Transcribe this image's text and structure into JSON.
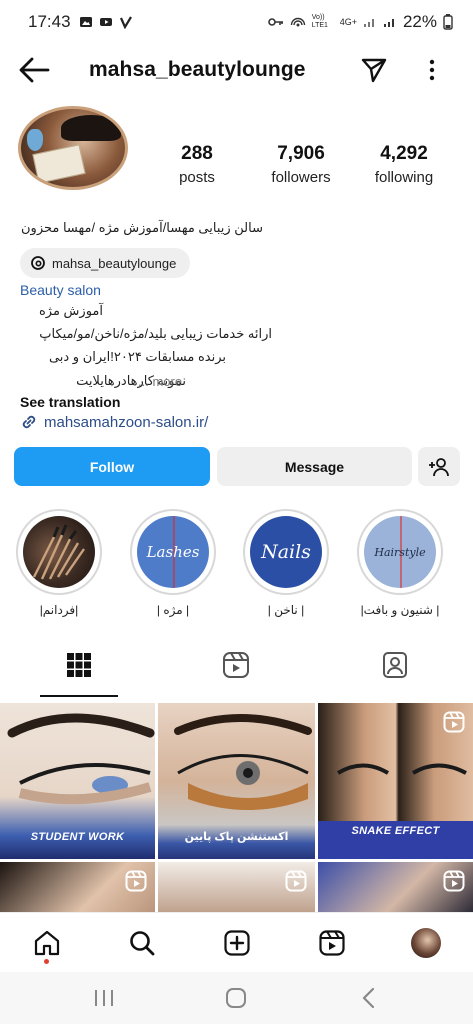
{
  "status_bar": {
    "time": "17:43",
    "network_label": "4G+",
    "volte_label": "Vo)) LTE1",
    "battery": "22%"
  },
  "header": {
    "username": "mahsa_beautylounge"
  },
  "profile": {
    "stats": [
      {
        "value": "288",
        "label": "posts"
      },
      {
        "value": "7,906",
        "label": "followers"
      },
      {
        "value": "4,292",
        "label": "following"
      }
    ],
    "name": "سالن زیبایی مهسا/آموزش مژه /مهسا محزون",
    "threads_handle": "mahsa_beautylounge",
    "category": "Beauty salon",
    "bio_lines": [
      "آموزش مژه",
      "ارائه خدمات زیبایی بلید/مژه/ناخن/مو/میکاپ",
      "برنده مسابقات ۲۰۲۴!ایران و دبی",
      "نمونه کارهادرهایلایت"
    ],
    "more_label": "... more",
    "see_translation": "See translation",
    "link": "mahsamahzoon-salon.ir/"
  },
  "actions": {
    "follow": "Follow",
    "message": "Message"
  },
  "highlights": [
    {
      "label": "|فردانم|",
      "word": "",
      "color": "#3b2a22"
    },
    {
      "label": "| مژه |",
      "word": "Lashes",
      "color": "#4f7cc9"
    },
    {
      "label": "| ناخن |",
      "word": "Nails",
      "color": "#2c4fa6"
    },
    {
      "label": "| شنیون و بافت|",
      "word": "Hairstyle",
      "color": "#9bb3d8"
    }
  ],
  "posts": [
    {
      "caption": "STUDENT WORK"
    },
    {
      "caption": "اکستنشن پاک پایین"
    },
    {
      "caption": "SNAKE EFFECT"
    }
  ],
  "icons": {
    "back": "arrow-left-icon",
    "send": "paper-plane-icon",
    "more": "vertical-dots-icon",
    "add_user": "add-person-icon",
    "grid_tab": "grid-icon",
    "reels_tab": "reels-icon",
    "tagged_tab": "tagged-person-icon",
    "home": "home-icon",
    "search": "search-icon",
    "create": "plus-square-icon",
    "reels": "reels-icon",
    "link": "link-chain-icon",
    "threads": "threads-logo-icon"
  },
  "colors": {
    "follow_button": "#1e9bf3",
    "link_text": "#2b4d8a",
    "category_text": "#2b5ea7"
  }
}
